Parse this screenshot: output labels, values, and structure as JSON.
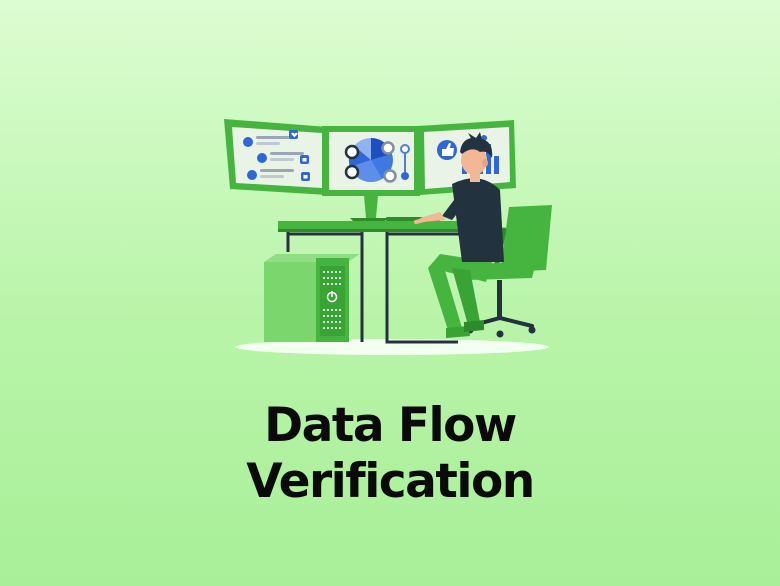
{
  "headline": {
    "line1": "Data Flow",
    "line2": "Verification"
  },
  "icons": {
    "thumbs_up": "thumbs-up-icon",
    "heart": "heart-icon",
    "power": "power-icon"
  },
  "palette": {
    "background_top": "#dcfdd2",
    "background_bottom": "#a8ef98",
    "brand_green": "#45b53f",
    "accent_blue": "#2f66d8",
    "text": "#0a0a0a"
  }
}
